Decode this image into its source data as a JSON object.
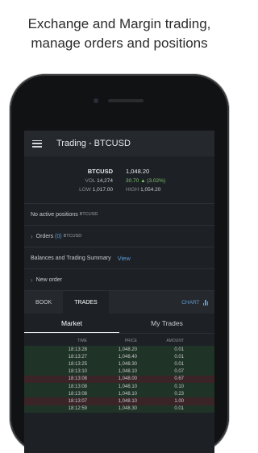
{
  "caption": {
    "line1": "Exchange and Margin trading,",
    "line2": "manage orders and positions"
  },
  "app": {
    "title": "Trading - BTCUSD",
    "menu_icon": "hamburger-menu-icon"
  },
  "ticker": {
    "symbol": "BTCUSD",
    "price": "1,048.20",
    "vol_label": "VOL",
    "vol_value": "14,274",
    "change": "30.70 ▲ (3.02%)",
    "low_label": "LOW",
    "low_value": "1,017.00",
    "high_label": "HIGH",
    "high_value": "1,054.20"
  },
  "positions": {
    "text": "No active positions",
    "symbol": "BTCUSD"
  },
  "orders": {
    "label": "Orders",
    "count": "(0)",
    "symbol": "BTCUSD"
  },
  "balances": {
    "label": "Balances and Trading Summary",
    "link": "View"
  },
  "new_order": {
    "label": "New order"
  },
  "tabs": {
    "book": "BOOK",
    "trades": "TRADES",
    "chart": "CHART"
  },
  "subtabs": {
    "market": "Market",
    "my_trades": "My Trades"
  },
  "trades_header": {
    "time": "TIME",
    "price": "PRICE",
    "amount": "AMOUNT"
  },
  "trades": [
    {
      "time": "18:13:28",
      "price": "1,048.20",
      "amount": "0.01",
      "side": "buy"
    },
    {
      "time": "18:13:27",
      "price": "1,048.40",
      "amount": "0.01",
      "side": "buy"
    },
    {
      "time": "18:13:25",
      "price": "1,048.30",
      "amount": "0.01",
      "side": "buy"
    },
    {
      "time": "18:13:10",
      "price": "1,048.10",
      "amount": "0.07",
      "side": "buy"
    },
    {
      "time": "18:13:08",
      "price": "1,048.00",
      "amount": "0.67",
      "side": "sell"
    },
    {
      "time": "18:13:08",
      "price": "1,048.10",
      "amount": "0.10",
      "side": "buy"
    },
    {
      "time": "18:13:08",
      "price": "1,048.10",
      "amount": "0.23",
      "side": "buy"
    },
    {
      "time": "18:13:07",
      "price": "1,048.10",
      "amount": "1.00",
      "side": "sell"
    },
    {
      "time": "18:12:59",
      "price": "1,048.30",
      "amount": "0.01",
      "side": "buy"
    }
  ],
  "colors": {
    "buy_row": "#1f3326",
    "sell_row": "#3a2428",
    "accent": "#5e9bd4",
    "positive": "#7ec36a"
  }
}
